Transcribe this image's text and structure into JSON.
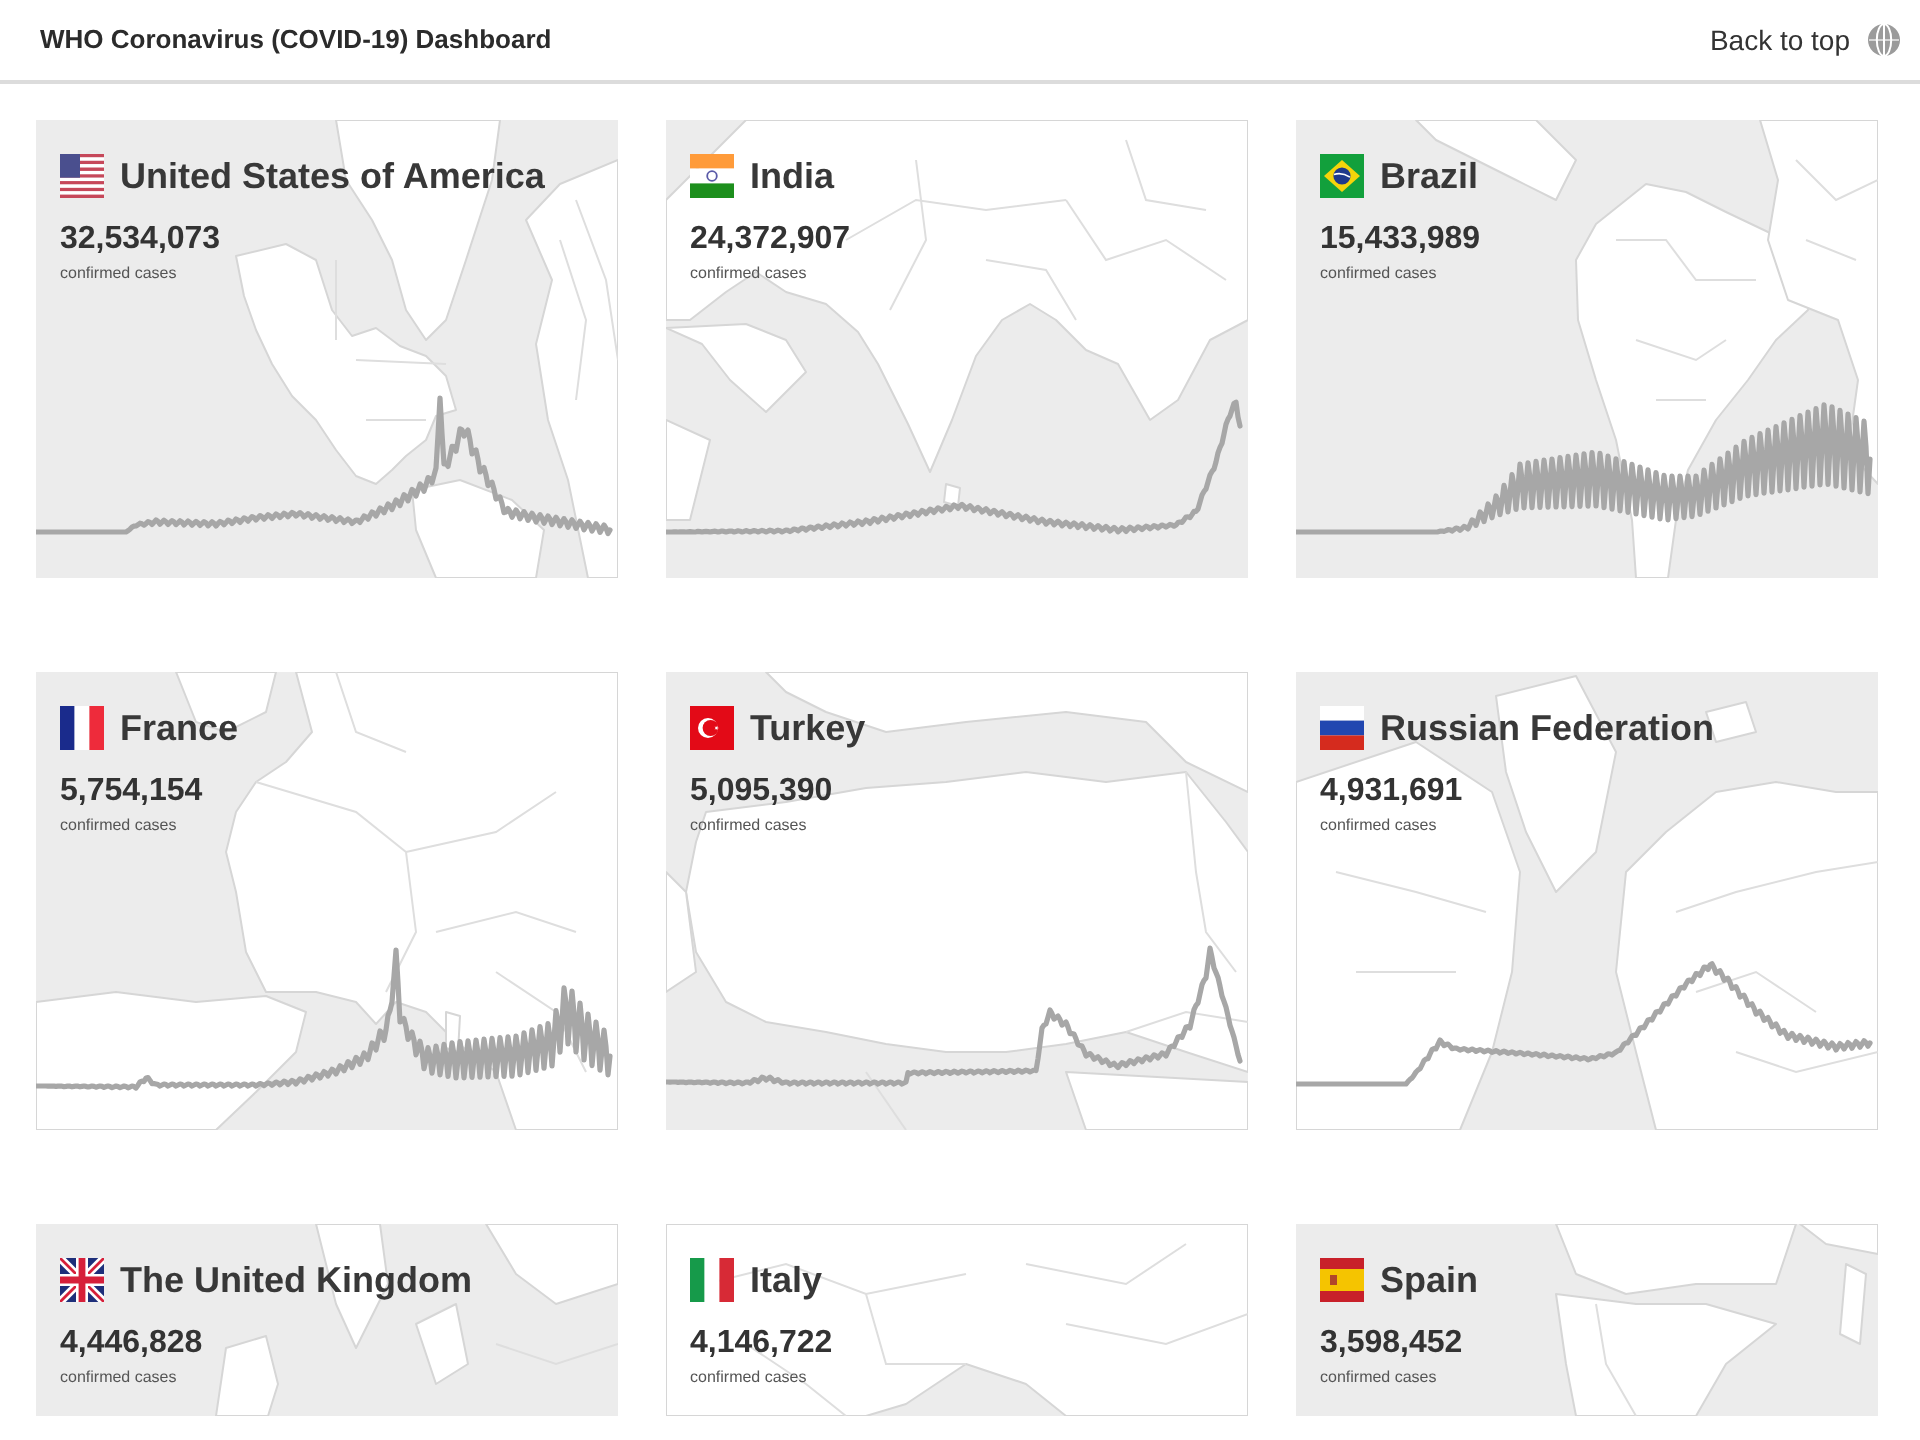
{
  "header": {
    "title": "WHO Coronavirus (COVID-19) Dashboard",
    "back_to_top": "Back to top"
  },
  "countries": [
    {
      "name": "United States of America",
      "cases": "32,534,073",
      "caption": "confirmed cases"
    },
    {
      "name": "India",
      "cases": "24,372,907",
      "caption": "confirmed cases"
    },
    {
      "name": "Brazil",
      "cases": "15,433,989",
      "caption": "confirmed cases"
    },
    {
      "name": "France",
      "cases": "5,754,154",
      "caption": "confirmed cases"
    },
    {
      "name": "Turkey",
      "cases": "5,095,390",
      "caption": "confirmed cases"
    },
    {
      "name": "Russian Federation",
      "cases": "4,931,691",
      "caption": "confirmed cases"
    },
    {
      "name": "The United Kingdom",
      "cases": "4,446,828",
      "caption": "confirmed cases"
    },
    {
      "name": "Italy",
      "cases": "4,146,722",
      "caption": "confirmed cases"
    },
    {
      "name": "Spain",
      "cases": "3,598,452",
      "caption": "confirmed cases"
    }
  ]
}
